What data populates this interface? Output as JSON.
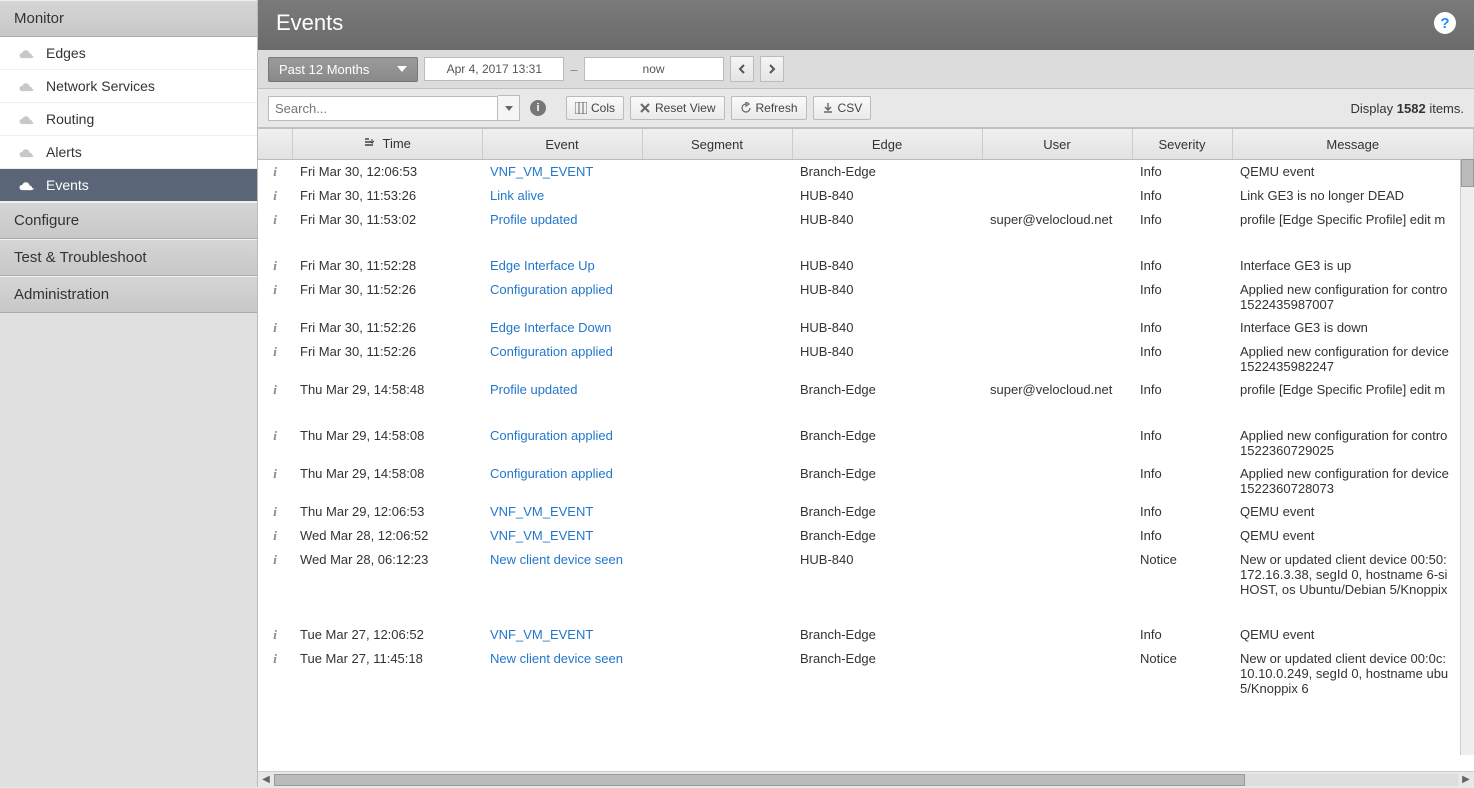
{
  "sidebar": {
    "sections": [
      {
        "label": "Monitor",
        "items": [
          {
            "label": "Edges",
            "active": false
          },
          {
            "label": "Network Services",
            "active": false
          },
          {
            "label": "Routing",
            "active": false
          },
          {
            "label": "Alerts",
            "active": false
          },
          {
            "label": "Events",
            "active": true
          }
        ]
      },
      {
        "label": "Configure",
        "items": []
      },
      {
        "label": "Test & Troubleshoot",
        "items": []
      },
      {
        "label": "Administration",
        "items": []
      }
    ]
  },
  "header": {
    "title": "Events"
  },
  "timebar": {
    "range_label": "Past 12 Months",
    "from": "Apr 4, 2017 13:31",
    "to": "now"
  },
  "toolbar": {
    "search_placeholder": "Search...",
    "cols": "Cols",
    "reset": "Reset View",
    "refresh": "Refresh",
    "csv": "CSV",
    "display_prefix": "Display ",
    "display_count": "1582",
    "display_suffix": " items."
  },
  "columns": {
    "time": "Time",
    "event": "Event",
    "segment": "Segment",
    "edge": "Edge",
    "user": "User",
    "severity": "Severity",
    "message": "Message"
  },
  "rows": [
    {
      "time": "Fri Mar 30, 12:06:53",
      "event": "VNF_VM_EVENT",
      "segment": "",
      "edge": "Branch-Edge",
      "user": "",
      "severity": "Info",
      "message": "QEMU event"
    },
    {
      "time": "Fri Mar 30, 11:53:26",
      "event": "Link alive",
      "segment": "",
      "edge": "HUB-840",
      "user": "",
      "severity": "Info",
      "message": "Link GE3 is no longer DEAD"
    },
    {
      "time": "Fri Mar 30, 11:53:02",
      "event": "Profile updated",
      "segment": "",
      "edge": "HUB-840",
      "user": "super@velocloud.net",
      "severity": "Info",
      "message": "profile [Edge Specific Profile] edit m"
    },
    {
      "spacer": true
    },
    {
      "time": "Fri Mar 30, 11:52:28",
      "event": "Edge Interface Up",
      "segment": "",
      "edge": "HUB-840",
      "user": "",
      "severity": "Info",
      "message": "Interface GE3 is up"
    },
    {
      "time": "Fri Mar 30, 11:52:26",
      "event": "Configuration applied",
      "segment": "",
      "edge": "HUB-840",
      "user": "",
      "severity": "Info",
      "message": "Applied new configuration for contro 1522435987007"
    },
    {
      "time": "Fri Mar 30, 11:52:26",
      "event": "Edge Interface Down",
      "segment": "",
      "edge": "HUB-840",
      "user": "",
      "severity": "Info",
      "message": "Interface GE3 is down"
    },
    {
      "time": "Fri Mar 30, 11:52:26",
      "event": "Configuration applied",
      "segment": "",
      "edge": "HUB-840",
      "user": "",
      "severity": "Info",
      "message": "Applied new configuration for device 1522435982247"
    },
    {
      "time": "Thu Mar 29, 14:58:48",
      "event": "Profile updated",
      "segment": "",
      "edge": "Branch-Edge",
      "user": "super@velocloud.net",
      "severity": "Info",
      "message": "profile [Edge Specific Profile] edit m"
    },
    {
      "spacer": true
    },
    {
      "time": "Thu Mar 29, 14:58:08",
      "event": "Configuration applied",
      "segment": "",
      "edge": "Branch-Edge",
      "user": "",
      "severity": "Info",
      "message": "Applied new configuration for contro 1522360729025"
    },
    {
      "time": "Thu Mar 29, 14:58:08",
      "event": "Configuration applied",
      "segment": "",
      "edge": "Branch-Edge",
      "user": "",
      "severity": "Info",
      "message": "Applied new configuration for device 1522360728073"
    },
    {
      "time": "Thu Mar 29, 12:06:53",
      "event": "VNF_VM_EVENT",
      "segment": "",
      "edge": "Branch-Edge",
      "user": "",
      "severity": "Info",
      "message": "QEMU event"
    },
    {
      "time": "Wed Mar 28, 12:06:52",
      "event": "VNF_VM_EVENT",
      "segment": "",
      "edge": "Branch-Edge",
      "user": "",
      "severity": "Info",
      "message": "QEMU event"
    },
    {
      "time": "Wed Mar 28, 06:12:23",
      "event": "New client device seen",
      "segment": "",
      "edge": "HUB-840",
      "user": "",
      "severity": "Notice",
      "message": "New or updated client device 00:50: 172.16.3.38, segId 0, hostname 6-si HOST, os Ubuntu/Debian 5/Knoppix"
    },
    {
      "spacer": true
    },
    {
      "time": "Tue Mar 27, 12:06:52",
      "event": "VNF_VM_EVENT",
      "segment": "",
      "edge": "Branch-Edge",
      "user": "",
      "severity": "Info",
      "message": "QEMU event"
    },
    {
      "time": "Tue Mar 27, 11:45:18",
      "event": "New client device seen",
      "segment": "",
      "edge": "Branch-Edge",
      "user": "",
      "severity": "Notice",
      "message": "New or updated client device 00:0c: 10.10.0.249, segId 0, hostname ubu 5/Knoppix 6"
    }
  ]
}
